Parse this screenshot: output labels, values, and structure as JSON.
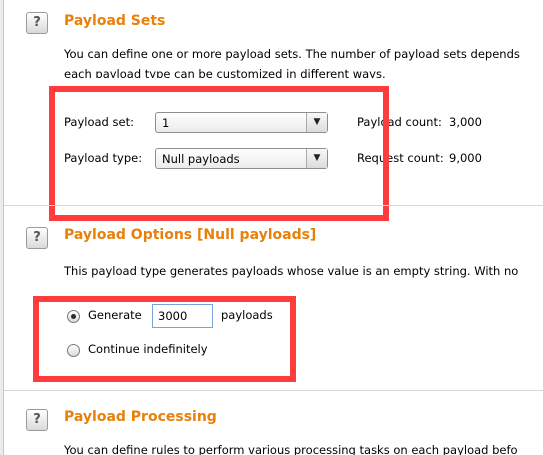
{
  "payload_sets": {
    "title": "Payload Sets",
    "description_line1": "You can define one or more payload sets. The number of payload sets depends",
    "description_line2": "each payload type can be customized in different ways.",
    "payload_set_label": "Payload set:",
    "payload_set_value": "1",
    "payload_type_label": "Payload type:",
    "payload_type_value": "Null payloads",
    "payload_count_label": "Payload count:",
    "payload_count_value": "3,000",
    "request_count_label": "Request count:",
    "request_count_value": "9,000"
  },
  "payload_options": {
    "title": "Payload Options [Null payloads]",
    "description": "This payload type generates payloads whose value is an empty string. With no",
    "generate_label": "Generate",
    "generate_value": "3000",
    "payloads_suffix": "payloads",
    "continue_label": "Continue indefinitely",
    "selected_option": "generate"
  },
  "payload_processing": {
    "title": "Payload Processing",
    "description": "You can define rules to perform various processing tasks on each payload befo"
  },
  "help_glyph": "?",
  "icons": {
    "help": "help-icon",
    "dropdown": "dropdown-arrow-icon"
  },
  "colors": {
    "section_title": "#e8800a",
    "highlight_box": "#ff3b3b"
  }
}
